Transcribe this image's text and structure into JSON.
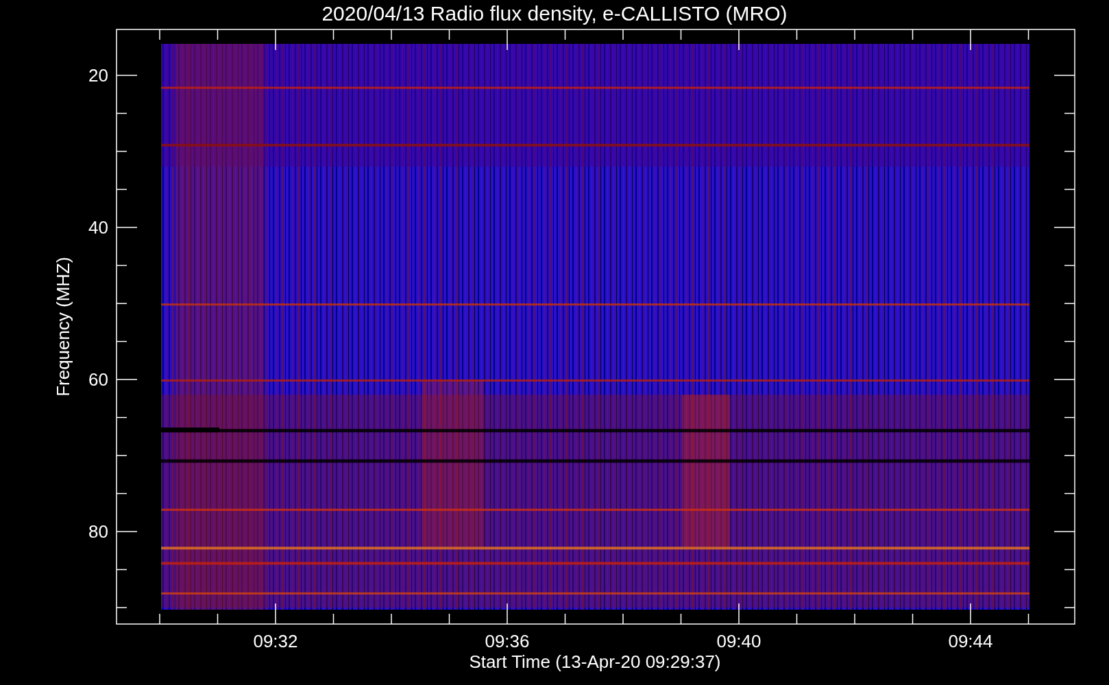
{
  "title": "2020/04/13  Radio flux density, e-CALLISTO (MRO)",
  "y_axis": {
    "label": "Frequency (MHZ)",
    "ticks": [
      "20",
      "40",
      "60",
      "80"
    ]
  },
  "x_axis": {
    "label": "Start Time (13-Apr-20 09:29:37)",
    "ticks": [
      "09:32",
      "09:36",
      "09:40",
      "09:44"
    ]
  }
}
